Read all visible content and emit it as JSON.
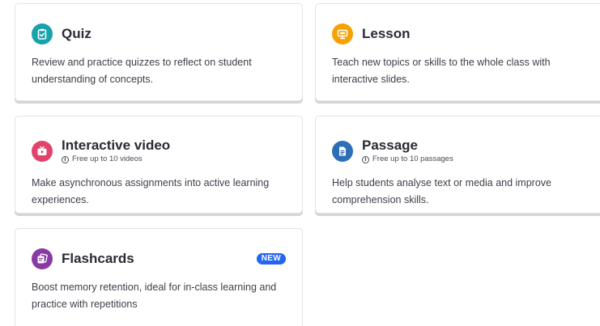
{
  "colors": {
    "quiz": "#17a2ac",
    "lesson": "#f5a100",
    "interactive_video": "#e2436a",
    "passage": "#2c6fb7",
    "flashcards": "#8a3aa3",
    "new_badge": "#2466f1"
  },
  "cards": {
    "quiz": {
      "icon": "clipboard-check-icon",
      "title": "Quiz",
      "description": "Review and practice quizzes to reflect on student understanding of concepts."
    },
    "lesson": {
      "icon": "presentation-icon",
      "title": "Lesson",
      "description": "Teach new topics or skills to the whole class with interactive slides."
    },
    "interactive_video": {
      "icon": "tv-play-icon",
      "title": "Interactive video",
      "note": "Free up to 10 videos",
      "description": "Make asynchronous assignments into active learning experiences."
    },
    "passage": {
      "icon": "document-icon",
      "title": "Passage",
      "note": "Free up to 10 passages",
      "description": "Help students analyse text or media and improve comprehension skills."
    },
    "flashcards": {
      "icon": "flashcards-icon",
      "title": "Flashcards",
      "badge": "NEW",
      "description": "Boost memory retention, ideal for in-class learning and practice with repetitions"
    }
  }
}
